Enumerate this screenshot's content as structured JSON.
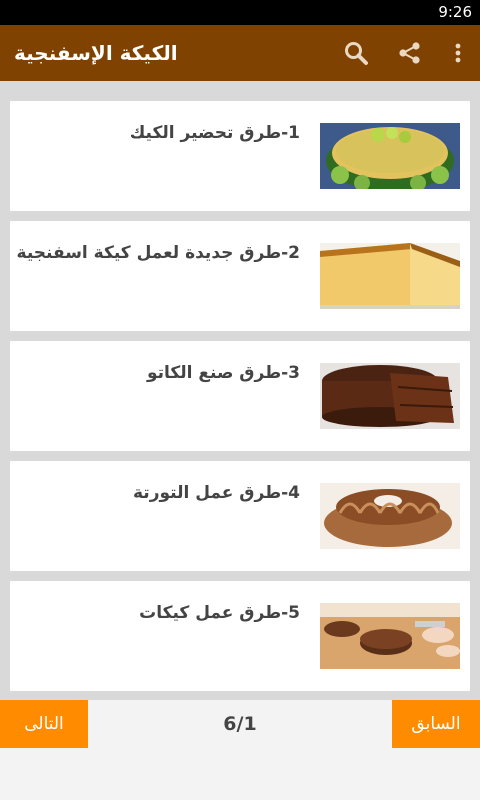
{
  "status": {
    "time": "9:26"
  },
  "app": {
    "title": "الكيكة الإسفنجية"
  },
  "icons": {
    "search": "search-icon",
    "share": "share-icon",
    "menu": "overflow-menu-icon"
  },
  "colors": {
    "action_bar": "#7f4200",
    "accent": "#ff8c00"
  },
  "items": [
    {
      "label": "1-طرق تحضير الكيك",
      "image": "lime-cake-image"
    },
    {
      "label": "2-طرق جديدة لعمل كيكة اسفنجية",
      "image": "sponge-cake-image"
    },
    {
      "label": "3-طرق صنع الكاتو",
      "image": "chocolate-cake-image"
    },
    {
      "label": "4-طرق عمل التورتة",
      "image": "bundt-cake-image"
    },
    {
      "label": "5-طرق عمل كيكات",
      "image": "cake-slicing-image"
    }
  ],
  "pagination": {
    "next_label": "التالى",
    "prev_label": "السابق",
    "indicator": "6/1"
  }
}
